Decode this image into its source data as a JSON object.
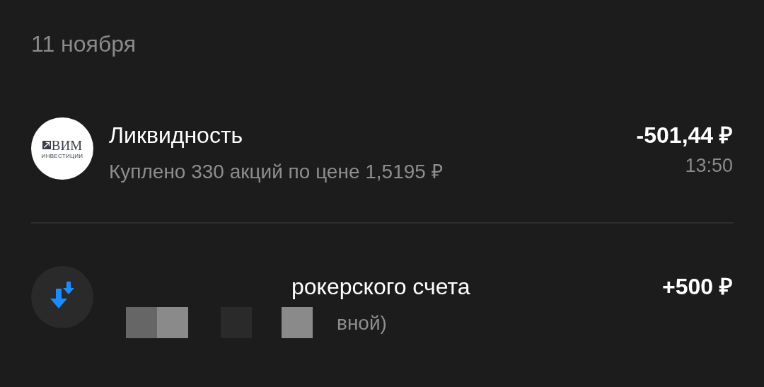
{
  "date": "11 ноября",
  "operations": [
    {
      "kind": "purchase",
      "logo": {
        "name": "ВИМ",
        "caption": "ИНВЕСТИЦИИ"
      },
      "title": "Ликвидность",
      "subtitle": "Куплено 330 акций по цене 1,5195 ₽",
      "amount": "-501,44 ₽",
      "time": "13:50"
    },
    {
      "kind": "deposit",
      "title": "рокерского счета",
      "subtitle": "вной)",
      "amount": "+500 ₽",
      "redacted": true
    }
  ]
}
